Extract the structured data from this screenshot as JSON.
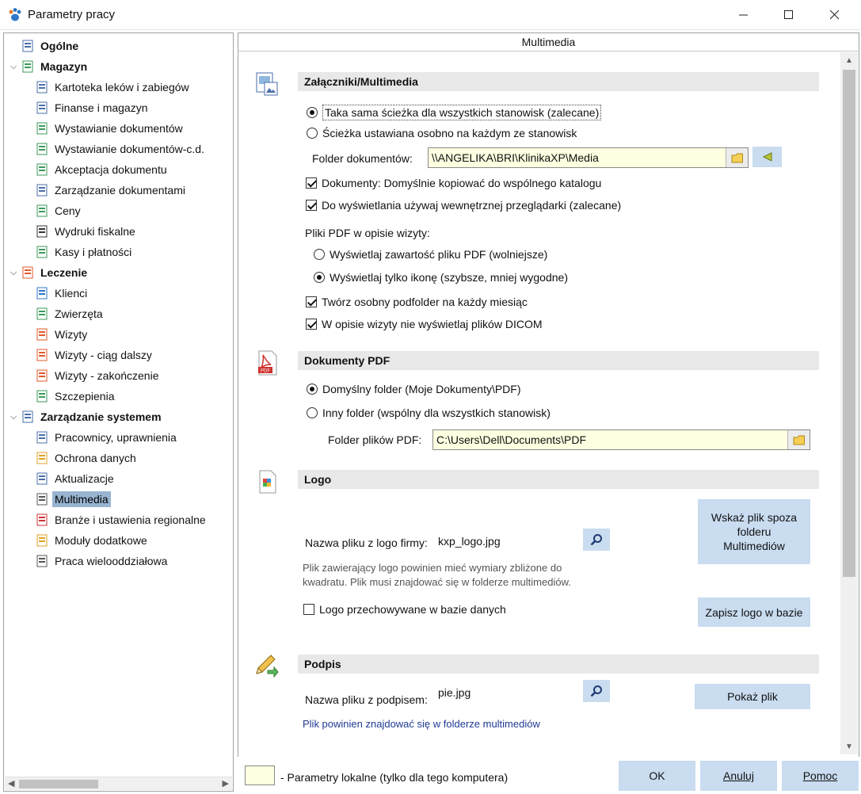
{
  "window": {
    "title": "Parametry pracy"
  },
  "tree": {
    "items": [
      {
        "label": "Ogólne",
        "group": true,
        "icon": "computer-icon"
      },
      {
        "label": "Magazyn",
        "group": true,
        "icon": "warehouse-icon"
      },
      {
        "label": "Kartoteka leków i zabiegów",
        "icon": "document-list-icon"
      },
      {
        "label": "Finanse i magazyn",
        "icon": "document-pages-icon"
      },
      {
        "label": "Wystawianie dokumentów",
        "icon": "document-add-icon"
      },
      {
        "label": "Wystawianie dokumentów-c.d.",
        "icon": "document-plus-icon"
      },
      {
        "label": "Akceptacja dokumentu",
        "icon": "document-plus-icon"
      },
      {
        "label": "Zarządzanie dokumentami",
        "icon": "document-pages-icon"
      },
      {
        "label": "Ceny",
        "icon": "money-icon"
      },
      {
        "label": "Wydruki fiskalne",
        "icon": "printer-icon"
      },
      {
        "label": "Kasy i płatności",
        "icon": "cash-register-icon"
      },
      {
        "label": "Leczenie",
        "group": true,
        "icon": "clipboard-icon"
      },
      {
        "label": "Klienci",
        "icon": "person-icon"
      },
      {
        "label": "Zwierzęta",
        "icon": "paw-icon"
      },
      {
        "label": "Wizyty",
        "icon": "clipboard-icon"
      },
      {
        "label": "Wizyty - ciąg dalszy",
        "icon": "clipboard-icon"
      },
      {
        "label": "Wizyty - zakończenie",
        "icon": "clipboard-icon"
      },
      {
        "label": "Szczepienia",
        "icon": "syringe-icon"
      },
      {
        "label": "Zarządzanie systemem",
        "group": true,
        "icon": "system-icon"
      },
      {
        "label": "Pracownicy, uprawnienia",
        "icon": "users-icon"
      },
      {
        "label": "Ochrona danych",
        "icon": "lock-icon"
      },
      {
        "label": "Aktualizacje",
        "icon": "update-icon"
      },
      {
        "label": "Multimedia",
        "icon": "multimedia-icon",
        "selected": true
      },
      {
        "label": "Branże i ustawienia regionalne",
        "icon": "region-icon"
      },
      {
        "label": "Moduły dodatkowe",
        "icon": "modules-icon"
      },
      {
        "label": "Praca wielooddziałowa",
        "icon": "home-icon"
      }
    ]
  },
  "panel": {
    "header": "Multimedia",
    "attachments": {
      "title": "Załączniki/Multimedia",
      "radio_same": "Taka sama ścieżka dla wszystkich stanowisk (zalecane)",
      "radio_separate": "Ścieżka ustawiana osobno na każdym ze stanowisk",
      "folder_label": "Folder dokumentów:",
      "folder_value": "\\\\ANGELIKA\\BRI\\KlinikaXP\\Media",
      "check_copy": "Dokumenty: Domyślnie kopiować do wspólnego katalogu",
      "check_viewer": "Do wyświetlania używaj wewnętrznej przeglądarki (zalecane)",
      "pdf_label": "Pliki PDF w opisie wizyty:",
      "radio_pdf_content": "Wyświetlaj zawartość pliku PDF (wolniejsze)",
      "radio_pdf_icon": "Wyświetlaj tylko ikonę (szybsze, mniej wygodne)",
      "check_subfolder": "Twórz osobny podfolder na każdy miesiąc",
      "check_dicom": "W opisie wizyty nie wyświetlaj plików DICOM"
    },
    "pdf_docs": {
      "title": "Dokumenty PDF",
      "radio_default": "Domyślny folder (Moje Dokumenty\\PDF)",
      "radio_other": "Inny folder (wspólny dla wszystkich stanowisk)",
      "folder_label": "Folder plików PDF:",
      "folder_value": "C:\\Users\\Dell\\Documents\\PDF"
    },
    "logo": {
      "title": "Logo",
      "file_label": "Nazwa pliku z logo firmy:",
      "file_value": "kxp_logo.jpg",
      "btn_outside": "Wskaż plik spoza folderu Multimediów",
      "note": "Plik zawierający logo powinien mieć wymiary zbliżone do kwadratu. Plik musi znajdować się w folderze multimediów.",
      "check_db": "Logo przechowywane w bazie danych",
      "btn_save": "Zapisz logo w bazie"
    },
    "signature": {
      "title": "Podpis",
      "file_label": "Nazwa pliku z podpisem:",
      "file_value": "pie.jpg",
      "btn_show": "Pokaż plik",
      "note": "Plik powinien znajdować się w folderze multimediów"
    }
  },
  "footer": {
    "legend": "- Parametry lokalne (tylko dla tego komputera)",
    "ok": "OK",
    "cancel": "Anuluj",
    "help": "Pomoc"
  },
  "colors": {
    "local_field": "#ffffe1",
    "button": "#c9dcf0",
    "selection": "#99b4d1",
    "section_bar": "#e8e8e8"
  }
}
